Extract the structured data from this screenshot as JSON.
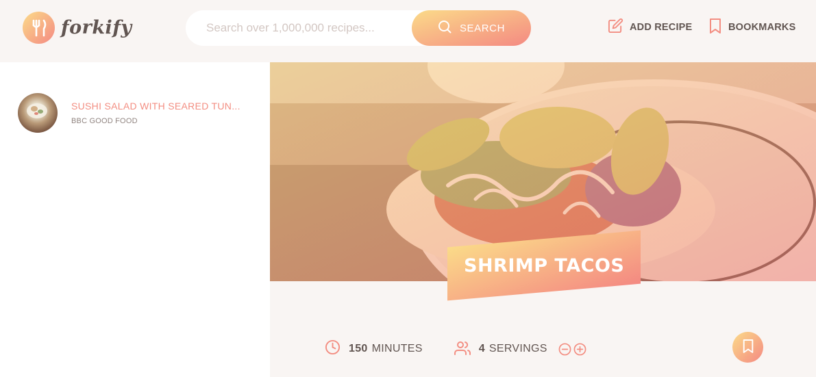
{
  "header": {
    "logo_text": "forkify",
    "search": {
      "placeholder": "Search over 1,000,000 recipes...",
      "value": "",
      "button_label": "SEARCH"
    },
    "nav": {
      "add_recipe_label": "ADD RECIPE",
      "bookmarks_label": "BOOKMARKS"
    }
  },
  "sidebar": {
    "results": [
      {
        "title": "SUSHI SALAD WITH SEARED TUN...",
        "publisher": "BBC GOOD FOOD"
      }
    ]
  },
  "recipe": {
    "title": "SHRIMP TACOS",
    "cooking_time": {
      "value": "150",
      "unit": "MINUTES"
    },
    "servings": {
      "value": "4",
      "unit": "SERVINGS"
    }
  },
  "colors": {
    "accent_start": "#fbdb89",
    "accent_end": "#f48982",
    "accent_text": "#f38e82",
    "text_main": "#615551",
    "background": "#f9f5f3"
  },
  "icons": {
    "logo": "fork-knife-icon",
    "search": "search-icon",
    "add_recipe": "edit-icon",
    "bookmarks": "bookmark-icon",
    "time": "clock-icon",
    "servings": "users-icon",
    "decrease": "minus-circle-icon",
    "increase": "plus-circle-icon",
    "bookmark_recipe": "bookmark-icon"
  }
}
